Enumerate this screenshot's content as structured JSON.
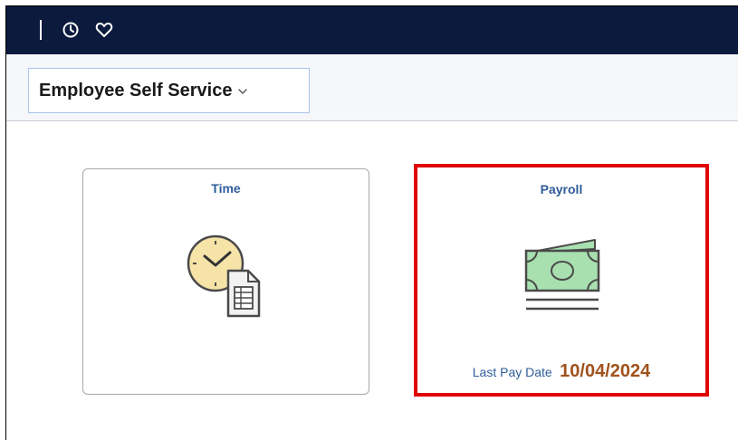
{
  "header": {
    "icons": [
      "clock-icon",
      "heart-icon"
    ]
  },
  "homepage_selector": {
    "label": "Employee Self Service"
  },
  "tiles": [
    {
      "title": "Time",
      "icon": "clock-with-document-icon"
    },
    {
      "title": "Payroll",
      "icon": "money-icon",
      "info_label": "Last Pay Date",
      "info_value": "10/04/2024"
    }
  ],
  "colors": {
    "header_bg": "#0b1a3d",
    "tile_title": "#2e5c9a",
    "pay_date": "#a0521d",
    "highlight": "#e00000"
  }
}
